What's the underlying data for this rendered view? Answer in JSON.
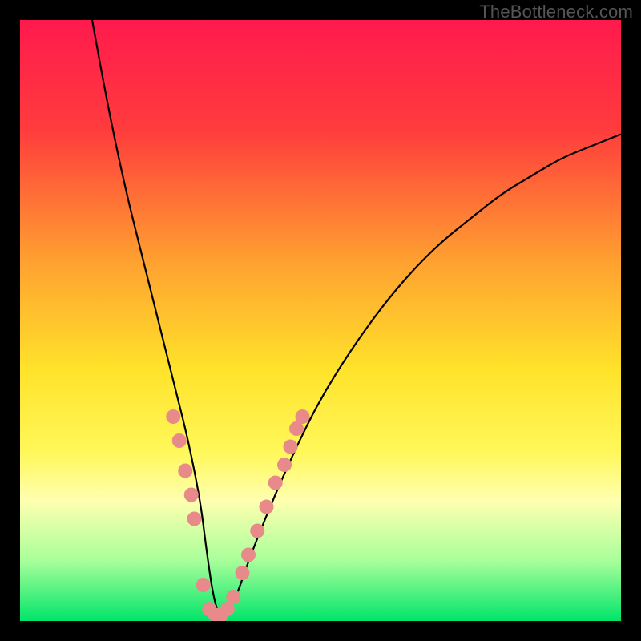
{
  "watermark": "TheBottleneck.com",
  "chart_data": {
    "type": "line",
    "title": "",
    "xlabel": "",
    "ylabel": "",
    "xlim": [
      0,
      100
    ],
    "ylim": [
      0,
      100
    ],
    "grid": false,
    "legend": false,
    "gradient_stops": [
      {
        "offset": 0,
        "color": "#ff1a4d"
      },
      {
        "offset": 18,
        "color": "#ff3b3d"
      },
      {
        "offset": 40,
        "color": "#ffa030"
      },
      {
        "offset": 58,
        "color": "#ffe22a"
      },
      {
        "offset": 72,
        "color": "#fff85a"
      },
      {
        "offset": 80,
        "color": "#ffffb0"
      },
      {
        "offset": 90,
        "color": "#a8ff9a"
      },
      {
        "offset": 100,
        "color": "#00e56a"
      }
    ],
    "series": [
      {
        "name": "bottleneck-curve",
        "x": [
          12,
          14,
          16,
          18,
          20,
          22,
          24,
          26,
          28,
          30,
          31,
          32,
          33,
          34,
          36,
          38,
          42,
          46,
          50,
          55,
          60,
          65,
          70,
          75,
          80,
          85,
          90,
          95,
          100
        ],
        "y": [
          100,
          89,
          79,
          70,
          62,
          54,
          46,
          38,
          30,
          20,
          12,
          5,
          1,
          1,
          4,
          10,
          20,
          29,
          37,
          45,
          52,
          58,
          63,
          67,
          71,
          74,
          77,
          79,
          81
        ]
      }
    ],
    "markers": {
      "name": "highlight-dots",
      "color": "#e88a8a",
      "radius": 9,
      "points": [
        {
          "x": 25.5,
          "y": 34
        },
        {
          "x": 26.5,
          "y": 30
        },
        {
          "x": 27.5,
          "y": 25
        },
        {
          "x": 28.5,
          "y": 21
        },
        {
          "x": 29.0,
          "y": 17
        },
        {
          "x": 30.5,
          "y": 6
        },
        {
          "x": 31.5,
          "y": 2
        },
        {
          "x": 32.5,
          "y": 1
        },
        {
          "x": 33.5,
          "y": 1
        },
        {
          "x": 34.5,
          "y": 2
        },
        {
          "x": 35.5,
          "y": 4
        },
        {
          "x": 37.0,
          "y": 8
        },
        {
          "x": 38.0,
          "y": 11
        },
        {
          "x": 39.5,
          "y": 15
        },
        {
          "x": 41.0,
          "y": 19
        },
        {
          "x": 42.5,
          "y": 23
        },
        {
          "x": 44.0,
          "y": 26
        },
        {
          "x": 45.0,
          "y": 29
        },
        {
          "x": 46.0,
          "y": 32
        },
        {
          "x": 47.0,
          "y": 34
        }
      ]
    }
  }
}
